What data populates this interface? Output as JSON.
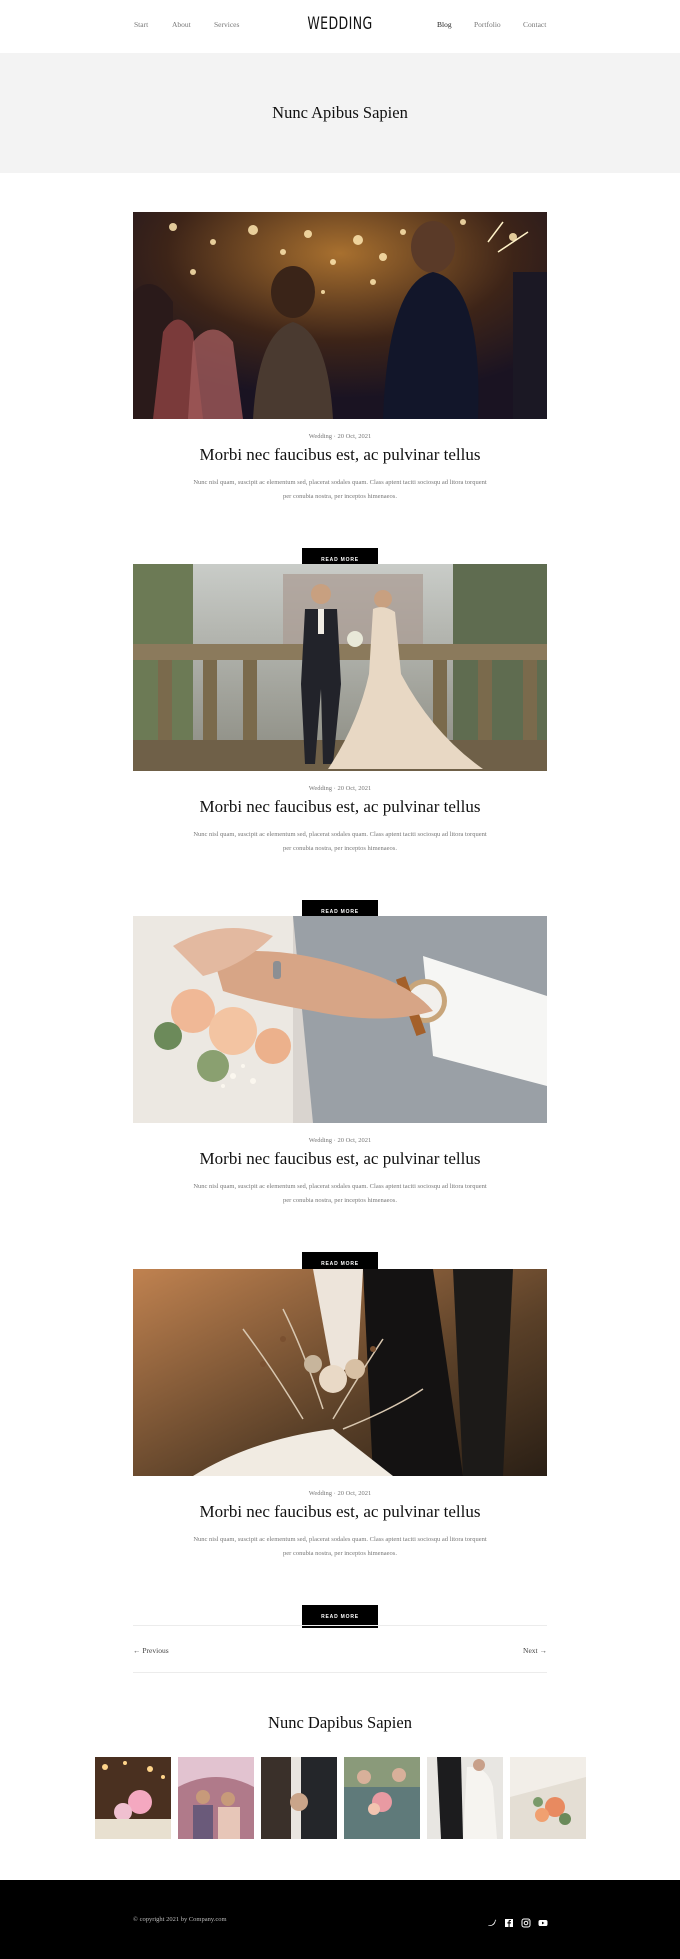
{
  "nav": {
    "logo": "WEDDING",
    "left": [
      "Start",
      "About",
      "Services"
    ],
    "right": [
      "Blog",
      "Portfolio",
      "Contact"
    ],
    "active": "Blog"
  },
  "hero": {
    "title": "Nunc Apibus Sapien"
  },
  "posts": [
    {
      "category": "Wedding",
      "date": "20 Oct, 2021",
      "meta": "Wedding  ·  20 Oct, 2021",
      "title": "Morbi nec faucibus est, ac pulvinar tellus",
      "excerpt": "Nunc nisl quam, suscipit ac elementum sed, placerat sodales quam. Class aptent taciti sociosqu ad litora torquent per conubia nostra, per inceptos himenaeos.",
      "button": "READ MORE"
    },
    {
      "category": "Wedding",
      "date": "20 Oct, 2021",
      "meta": "Wedding  ·  20 Oct, 2021",
      "title": "Morbi nec faucibus est, ac pulvinar tellus",
      "excerpt": "Nunc nisl quam, suscipit ac elementum sed, placerat sodales quam. Class aptent taciti sociosqu ad litora torquent per conubia nostra, per inceptos himenaeos.",
      "button": "READ MORE"
    },
    {
      "category": "Wedding",
      "date": "20 Oct, 2021",
      "meta": "Wedding  ·  20 Oct, 2021",
      "title": "Morbi nec faucibus est, ac pulvinar tellus",
      "excerpt": "Nunc nisl quam, suscipit ac elementum sed, placerat sodales quam. Class aptent taciti sociosqu ad litora torquent per conubia nostra, per inceptos himenaeos.",
      "button": "READ MORE"
    },
    {
      "category": "Wedding",
      "date": "20 Oct, 2021",
      "meta": "Wedding  ·  20 Oct, 2021",
      "title": "Morbi nec faucibus est, ac pulvinar tellus",
      "excerpt": "Nunc nisl quam, suscipit ac elementum sed, placerat sodales quam. Class aptent taciti sociosqu ad litora torquent per conubia nostra, per inceptos himenaeos.",
      "button": "READ MORE"
    }
  ],
  "pagination": {
    "prev": "← Previous",
    "next": "Next →"
  },
  "gallery": {
    "title": "Nunc Dapibus Sapien"
  },
  "footer": {
    "copyright": "© copyright 2021 by Company.com",
    "social": [
      "twitter-icon",
      "facebook-icon",
      "instagram-icon",
      "youtube-icon"
    ]
  },
  "colors": {
    "hero_bg": "#f3f3f3",
    "footer_bg": "#000000",
    "button_bg": "#000000"
  }
}
